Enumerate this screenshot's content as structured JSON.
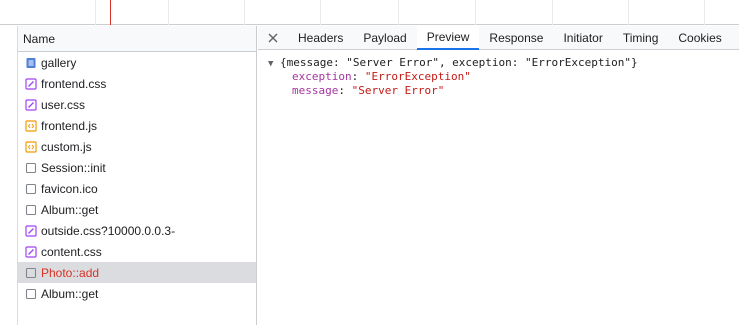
{
  "colors": {
    "error_text": "#d93025",
    "active_tab": "#1a73e8",
    "selected_row": "#dadce0"
  },
  "list": {
    "column_header": "Name",
    "rows": [
      {
        "label": "gallery",
        "icon": "document-icon",
        "status": "normal"
      },
      {
        "label": "frontend.css",
        "icon": "stylesheet-icon",
        "status": "normal"
      },
      {
        "label": "user.css",
        "icon": "stylesheet-icon",
        "status": "normal"
      },
      {
        "label": "frontend.js",
        "icon": "script-icon",
        "status": "normal"
      },
      {
        "label": "custom.js",
        "icon": "script-icon",
        "status": "normal"
      },
      {
        "label": "Session::init",
        "icon": "fetch-icon",
        "status": "normal"
      },
      {
        "label": "favicon.ico",
        "icon": "fetch-icon",
        "status": "normal"
      },
      {
        "label": "Album::get",
        "icon": "fetch-icon",
        "status": "normal"
      },
      {
        "label": "outside.css?10000.0.0.3-",
        "icon": "stylesheet-icon",
        "status": "normal"
      },
      {
        "label": "content.css",
        "icon": "stylesheet-icon",
        "status": "normal"
      },
      {
        "label": "Photo::add",
        "icon": "fetch-icon",
        "status": "error-selected"
      },
      {
        "label": "Album::get",
        "icon": "fetch-icon",
        "status": "normal"
      }
    ]
  },
  "detail": {
    "close_icon": "close-icon",
    "tabs": [
      "Headers",
      "Payload",
      "Preview",
      "Response",
      "Initiator",
      "Timing",
      "Cookies"
    ],
    "active_tab": "Preview",
    "preview": {
      "summary": "{message: \"Server Error\", exception: \"ErrorException\"}",
      "properties": [
        {
          "key": "exception",
          "value": "\"ErrorException\""
        },
        {
          "key": "message",
          "value": "\"Server Error\""
        }
      ]
    }
  }
}
